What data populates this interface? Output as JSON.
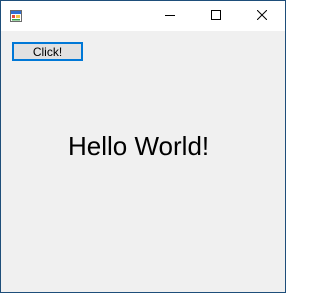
{
  "window": {
    "app_icon": "winforms-app-icon",
    "controls": {
      "minimize_icon": "minimize-icon",
      "maximize_icon": "maximize-icon",
      "close_icon": "close-icon"
    }
  },
  "form": {
    "button_label": "Click!",
    "message": "Hello World!"
  },
  "colors": {
    "focus_border": "#0078d7",
    "client_background": "#f0f0f0",
    "window_border": "#1e4e7a"
  }
}
